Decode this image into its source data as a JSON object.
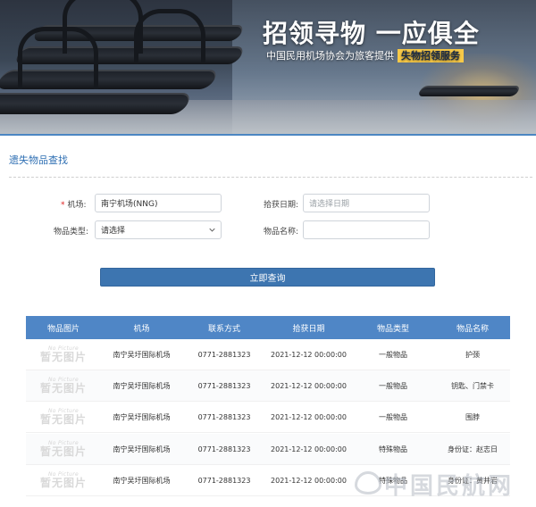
{
  "banner": {
    "title": "招领寻物 一应俱全",
    "subtitle": "中国民用机场协会为旅客提供",
    "subtitle_highlight": "失物招领服务"
  },
  "section": {
    "title": "遗失物品查找"
  },
  "form": {
    "airport_label": "机场:",
    "airport_required": "*",
    "airport_value": "南宁机场(NNG)",
    "date_label": "拾获日期:",
    "date_placeholder": "请选择日期",
    "type_label": "物品类型:",
    "type_value": "请选择",
    "name_label": "物品名称:",
    "name_value": "",
    "search_button": "立即查询"
  },
  "table": {
    "headers": [
      "物品图片",
      "机场",
      "联系方式",
      "拾获日期",
      "物品类型",
      "物品名称"
    ],
    "no_picture_en": "No Picture",
    "no_picture_cn": "暂无图片",
    "rows": [
      {
        "airport": "南宁吴圩国际机场",
        "phone": "0771-2881323",
        "date": "2021-12-12 00:00:00",
        "type": "一般物品",
        "name": "护颈"
      },
      {
        "airport": "南宁吴圩国际机场",
        "phone": "0771-2881323",
        "date": "2021-12-12 00:00:00",
        "type": "一般物品",
        "name": "钥匙、门禁卡"
      },
      {
        "airport": "南宁吴圩国际机场",
        "phone": "0771-2881323",
        "date": "2021-12-12 00:00:00",
        "type": "一般物品",
        "name": "围脖"
      },
      {
        "airport": "南宁吴圩国际机场",
        "phone": "0771-2881323",
        "date": "2021-12-12 00:00:00",
        "type": "特殊物品",
        "name": "身份证：赵志日"
      },
      {
        "airport": "南宁吴圩国际机场",
        "phone": "0771-2881323",
        "date": "2021-12-12 00:00:00",
        "type": "特殊物品",
        "name": "身份证：黄井岩"
      }
    ]
  },
  "watermark": {
    "text": "中国民航网"
  },
  "colors": {
    "primary": "#3d75b0",
    "header_bg": "#4f86c6",
    "section_title": "#2f6fb3",
    "required": "#e02020",
    "highlight": "#f7c948"
  }
}
